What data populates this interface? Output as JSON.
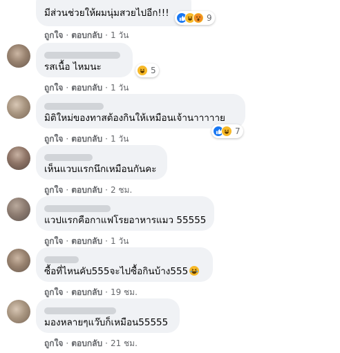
{
  "comments": [
    {
      "text": "มีส่วนช่วยให้ผมนุ่มสวยไปอีก!!!",
      "like": "ถูกใจ",
      "reply": "ตอบกลับ",
      "time": "1 วัน",
      "reaction_icons": [
        "like-icon",
        "haha-icon",
        "wow-icon"
      ],
      "reaction_count": "9"
    },
    {
      "text": "รสเนื้อ ไหมนะ",
      "like": "ถูกใจ",
      "reply": "ตอบกลับ",
      "time": "1 วัน",
      "reaction_icons": [
        "haha-icon"
      ],
      "reaction_count": "5"
    },
    {
      "text": "มิติใหม่ของทาสต้องกินให้เหมือนเจ้านาาาาาย",
      "like": "ถูกใจ",
      "reply": "ตอบกลับ",
      "time": "1 วัน",
      "reaction_icons": [
        "like-icon",
        "haha-icon"
      ],
      "reaction_count": "7"
    },
    {
      "text": "เห็นแวบแรกนึกเหมือนกันคะ",
      "like": "ถูกใจ",
      "reply": "ตอบกลับ",
      "time": "2 ชม."
    },
    {
      "text": "แวปแรกคือกาแฟโรยอาหารแมว 55555",
      "like": "ถูกใจ",
      "reply": "ตอบกลับ",
      "time": "1 วัน"
    },
    {
      "text": "ซื้อที่ไหนคับ555จะไปซื้อกินบ้าง555",
      "emoji": "haha-emoji",
      "like": "ถูกใจ",
      "reply": "ตอบกลับ",
      "time": "19 ชม."
    },
    {
      "text": "มองหลายๆแว๊บก็เหมือน55555",
      "like": "ถูกใจ",
      "reply": "ตอบกลับ",
      "time": "21 ชม."
    }
  ],
  "separator": "·",
  "colors": {
    "bubble": "#f0f2f5",
    "meta": "#65676b",
    "like": "#1877f2",
    "haha": "#f7b928"
  }
}
